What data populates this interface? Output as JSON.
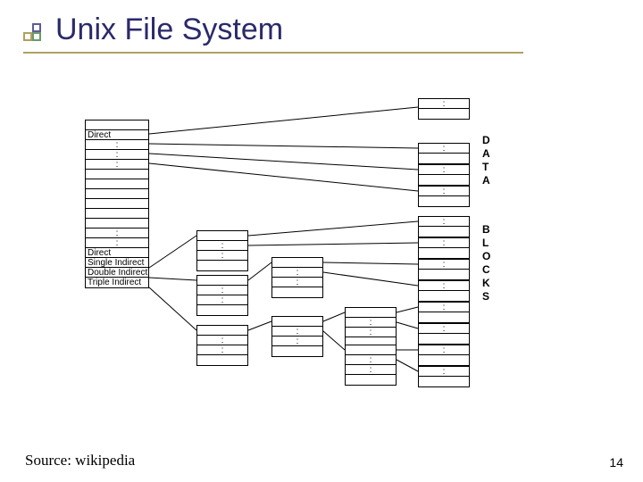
{
  "title": "Unix File System",
  "source": "Source: wikipedia",
  "page_number": "14",
  "inode": {
    "direct_top": "Direct",
    "direct_bottom": "Direct",
    "single": "Single Indirect",
    "double": "Double Indirect",
    "triple": "Triple Indirect"
  },
  "vlabel_data": [
    "D",
    "A",
    "T",
    "A"
  ],
  "vlabel_blocks": [
    "B",
    "L",
    "O",
    "C",
    "K",
    "S"
  ],
  "dots": ":"
}
